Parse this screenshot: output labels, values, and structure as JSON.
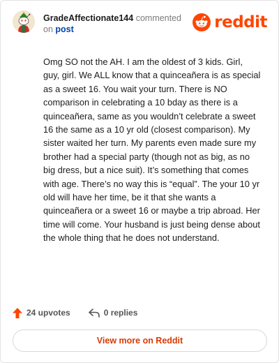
{
  "header": {
    "username": "GradeAffectionate144",
    "commented_text": "commented",
    "on_text": "on",
    "post_link": "post",
    "logo_text": "reddit"
  },
  "comment": {
    "body": "Omg SO not the AH. I am the oldest of 3 kids. Girl, guy, girl. We ALL know that a quinceañera is as special as a sweet 16. You wait your turn. There is NO comparison in celebrating a 10 bday as there is a quinceañera, same as you wouldn’t celebrate a sweet 16 the same as a 10 yr old (closest comparison). My sister waited her turn. My parents even made sure my brother had a special party (though not as big, as no big dress, but a nice suit). It’s something that comes with age. There’s no way this is “equal”. The your 10 yr old will have her time, be it that she wants a quinceañera or a sweet 16 or maybe a trip abroad. Her time will come. Your husband is just being dense about the whole thing that he does not understand."
  },
  "actions": {
    "upvotes": "24 upvotes",
    "replies": "0 replies"
  },
  "footer": {
    "view_more": "View more on Reddit"
  },
  "colors": {
    "brand": "#ff4500",
    "upvote": "#ff4500",
    "link": "#0045ac",
    "cta": "#d93a00"
  },
  "icons": {
    "avatar": "snoo-avatar",
    "logo": "reddit-snoo-icon",
    "upvote": "upvote-arrow-icon",
    "reply": "reply-arrow-icon"
  }
}
